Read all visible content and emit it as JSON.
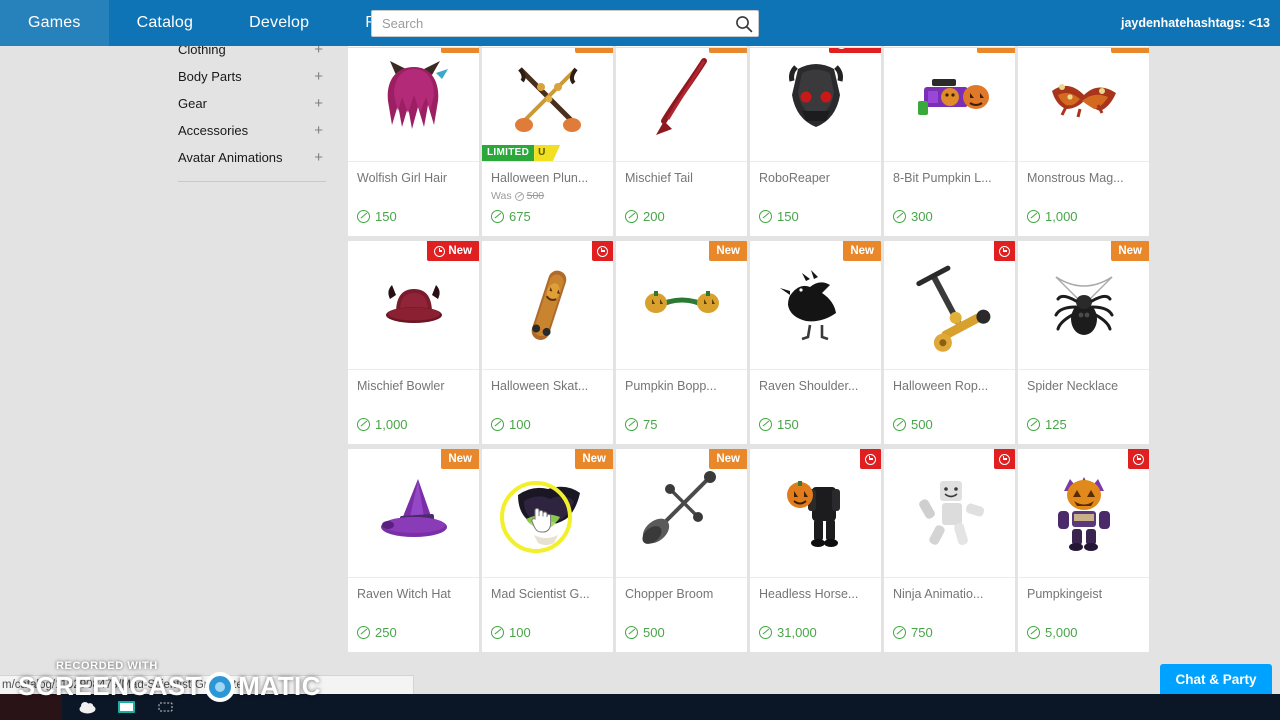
{
  "nav": {
    "links": [
      {
        "label": "Games"
      },
      {
        "label": "Catalog"
      },
      {
        "label": "Develop"
      },
      {
        "label": "Robux"
      }
    ],
    "search_placeholder": "Search",
    "search_value": "",
    "search_icon": "search-icon",
    "username": "jaydenhatehashtags: <13",
    "bar_color": "#0f74b5"
  },
  "sidebar": {
    "items": [
      {
        "label": "Clothing",
        "expander": "+"
      },
      {
        "label": "Body Parts",
        "expander": "+"
      },
      {
        "label": "Gear",
        "expander": "+"
      },
      {
        "label": "Accessories",
        "expander": "+"
      },
      {
        "label": "Avatar Animations",
        "expander": "+"
      }
    ]
  },
  "catalog": {
    "currency_icon": "robux-icon",
    "was_label": "Was",
    "badge_new_label": "New",
    "limited_label": "LIMITED",
    "limited_suffix": "U",
    "rows": [
      [
        {
          "title": "Wolfish Girl Hair",
          "price": "150",
          "badge": "new",
          "art": "hair"
        },
        {
          "title": "Halloween Plun...",
          "price": "675",
          "badge": "new",
          "was": "500",
          "limited": true,
          "art": "plunder"
        },
        {
          "title": "Mischief Tail",
          "price": "200",
          "badge": "new",
          "art": "tail"
        },
        {
          "title": "RoboReaper",
          "price": "150",
          "badge": "timer-new",
          "art": "roboreaper"
        },
        {
          "title": "8-Bit Pumpkin L...",
          "price": "300",
          "badge": "new",
          "art": "launcher"
        },
        {
          "title": "Monstrous Mag...",
          "price": "1,000",
          "badge": "new",
          "art": "magic"
        }
      ],
      [
        {
          "title": "Mischief Bowler",
          "price": "1,000",
          "badge": "timer-new",
          "art": "bowler"
        },
        {
          "title": "Halloween Skat...",
          "price": "100",
          "badge": "timer",
          "art": "skateboard"
        },
        {
          "title": "Pumpkin Bopp...",
          "price": "75",
          "badge": "new",
          "art": "bopper"
        },
        {
          "title": "Raven Shoulder...",
          "price": "150",
          "badge": "new",
          "art": "raven"
        },
        {
          "title": "Halloween Rop...",
          "price": "500",
          "badge": "timer",
          "art": "scooter"
        },
        {
          "title": "Spider Necklace",
          "price": "125",
          "badge": "new",
          "art": "spider"
        }
      ],
      [
        {
          "title": "Raven Witch Hat",
          "price": "250",
          "badge": "new",
          "art": "witchhat"
        },
        {
          "title": "Mad Scientist G...",
          "price": "100",
          "badge": "new",
          "art": "madscientist"
        },
        {
          "title": "Chopper Broom",
          "price": "500",
          "badge": "new",
          "art": "broom"
        },
        {
          "title": "Headless Horse...",
          "price": "31,000",
          "badge": "timer",
          "art": "headless"
        },
        {
          "title": "Ninja Animatio...",
          "price": "750",
          "badge": "timer",
          "art": "ninja"
        },
        {
          "title": "Pumpkingeist",
          "price": "5,000",
          "badge": "timer",
          "art": "pumpkingeist"
        }
      ]
    ]
  },
  "status": {
    "url": "m/catalog/1192908479/Mad-Scientist-Graduate"
  },
  "chat": {
    "label": "Chat & Party",
    "color": "#00a2ff"
  },
  "watermark": {
    "line1": "RECORDED WITH",
    "line2a": "SCREENCAST",
    "line2b": "MATIC"
  },
  "colors": {
    "accent_new": "#e8882a",
    "accent_timer": "#e02020",
    "price_green": "#4aa44a",
    "limited_green": "#2aa83a"
  }
}
